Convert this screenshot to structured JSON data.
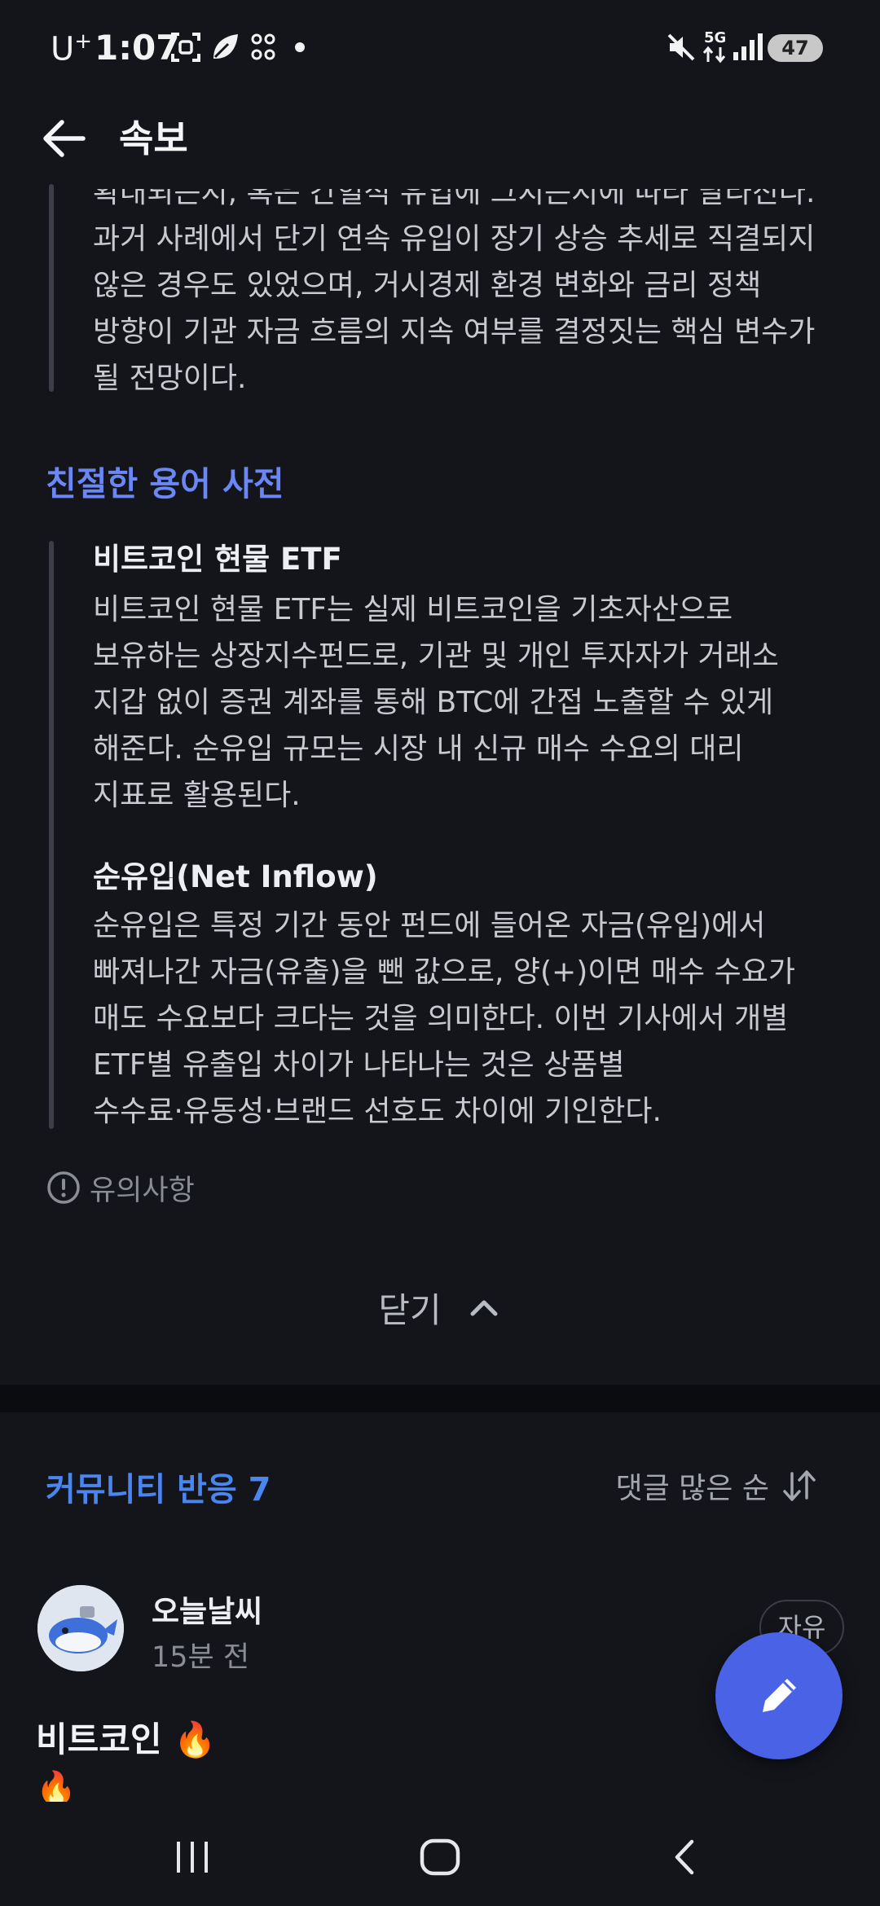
{
  "status_bar": {
    "carrier": "U",
    "carrier_sup": "+",
    "time": "1:07",
    "network": "5G",
    "battery": "47"
  },
  "app_bar": {
    "title": "속보"
  },
  "article": {
    "top_paragraph_lines": [
      "확대되는지, 혹은 간헐적 유입에 그치는지에 따라 달라진다.",
      "과거 사례에서 단기 연속 유입이 장기 상승 추세로 직결되지",
      "않은 경우도 있었으며, 거시경제 환경 변화와 금리 정책",
      "방향이 기관 자금 흐름의 지속 여부를 결정짓는 핵심 변수가",
      "될 전망이다."
    ],
    "glossary_title": "친절한 용어 사전",
    "terms": [
      {
        "term": "비트코인 현물 ETF",
        "lines": [
          "비트코인 현물 ETF는 실제 비트코인을 기초자산으로",
          "보유하는 상장지수펀드로, 기관 및 개인 투자자가 거래소",
          "지갑 없이 증권 계좌를 통해 BTC에 간접 노출할 수 있게",
          "해준다. 순유입 규모는 시장 내 신규 매수 수요의 대리",
          "지표로 활용된다."
        ]
      },
      {
        "term": "순유입(Net Inflow)",
        "lines": [
          "순유입은 특정 기간 동안 펀드에 들어온 자금(유입)에서",
          "빠져나간 자금(유출)을 뺀 값으로, 양(+)이면 매수 수요가",
          "매도 수요보다 크다는 것을 의미한다. 이번 기사에서 개별",
          "ETF별 유출입 차이가 나타나는 것은 상품별",
          "수수료·유동성·브랜드 선호도 차이에 기인한다."
        ]
      }
    ],
    "notice_label": "유의사항",
    "close_label": "닫기"
  },
  "community": {
    "title": "커뮤니티 반응 7",
    "sort_label": "댓글 많은 순",
    "post": {
      "username": "오늘날씨",
      "time_ago": "15분 전",
      "tag": "자유",
      "title": "비트코인 🔥",
      "body": "🔥"
    }
  },
  "icons": {
    "back": "arrow-left-icon",
    "notice": "info-circle-icon",
    "close": "chevron-up-icon",
    "sort": "sort-arrows-icon",
    "fab": "pencil-icon"
  },
  "colors": {
    "background": "#13151b",
    "accent_blue": "#4b86f0",
    "glossary_title": "#6a87f5",
    "fab": "#4a62e6"
  }
}
